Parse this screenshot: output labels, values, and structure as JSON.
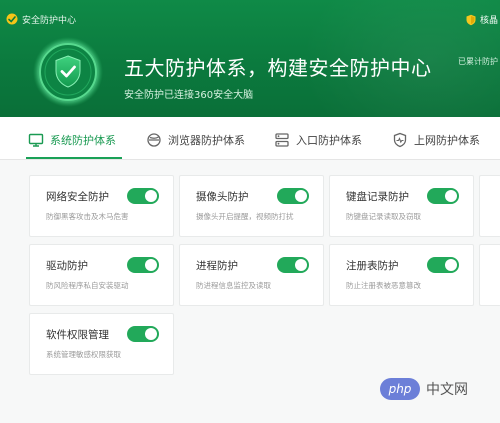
{
  "window": {
    "title": "安全防护中心",
    "logo_icon": "360-logo-icon",
    "user_icon": "shield-badge-icon",
    "user_name": "核晶"
  },
  "banner": {
    "headline": "五大防护体系，构建安全防护中心",
    "subline": "安全防护已连接360安全大脑",
    "blocked_text": "已累计防护",
    "shield_icon": "shield-check-icon"
  },
  "tabs": [
    {
      "label": "系统防护体系",
      "icon": "monitor-icon",
      "active": true
    },
    {
      "label": "浏览器防护体系",
      "icon": "browser-icon",
      "active": false
    },
    {
      "label": "入口防护体系",
      "icon": "entry-icon",
      "active": false
    },
    {
      "label": "上网防护体系",
      "icon": "shield-pulse-icon",
      "active": false
    }
  ],
  "cards": [
    {
      "name": "网络安全防护",
      "desc": "防御黑客攻击及木马危害",
      "enabled": true
    },
    {
      "name": "摄像头防护",
      "desc": "摄像头开启提醒，视频防打扰",
      "enabled": true
    },
    {
      "name": "键盘记录防护",
      "desc": "防键盘记录读取及窃取",
      "enabled": true
    },
    {
      "name": "驱动防护",
      "desc": "防风险程序私自安装驱动",
      "enabled": true
    },
    {
      "name": "进程防护",
      "desc": "防进程信息监控及读取",
      "enabled": true
    },
    {
      "name": "注册表防护",
      "desc": "防止注册表被恶意篡改",
      "enabled": true
    },
    {
      "name": "软件权限管理",
      "desc": "系统管理敏感权限获取",
      "enabled": true
    }
  ],
  "colors": {
    "header_green": "#0f8a47",
    "accent_green": "#1aa157",
    "toggle_on": "#22a95a"
  },
  "watermark": {
    "logo_text": "php",
    "text": "中文网"
  }
}
